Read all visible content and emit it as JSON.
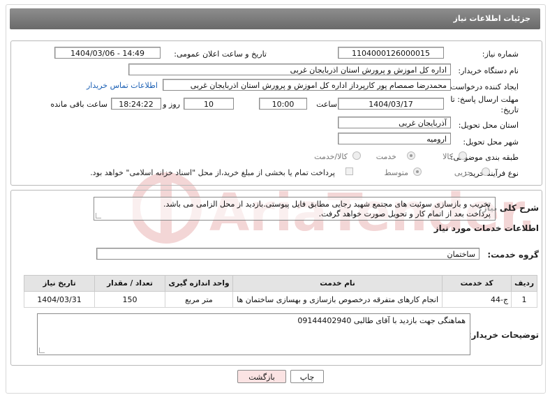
{
  "header": {
    "title": "جزئیات اطلاعات نیاز"
  },
  "form": {
    "need_number_label": "شماره نیاز:",
    "need_number": "1104000126000015",
    "announce_datetime_label": "تاریخ و ساعت اعلان عمومی:",
    "announce_datetime": "1404/03/06 - 14:49",
    "buyer_org_label": "نام دستگاه خریدار:",
    "buyer_org": "اداره کل اموزش و پرورش استان اذربایجان غربی",
    "requester_label": "ایجاد کننده درخواست:",
    "requester": "محمدرضا صمصام پور کارپرداز اداره کل اموزش و پرورش استان اذربایجان غربی",
    "contact_link": "اطلاعات تماس خریدار",
    "deadline_label_1": "مهلت ارسال پاسخ: تا",
    "deadline_label_2": "تاریخ:",
    "deadline_date": "1404/03/17",
    "time_label": "ساعت",
    "deadline_time": "10:00",
    "days_value": "10",
    "days_label": "روز و",
    "remaining_time": "18:24:22",
    "remaining_label": "ساعت باقی مانده",
    "province_label": "استان محل تحویل:",
    "province": "آذربایجان غربی",
    "city_label": "شهر محل تحویل:",
    "city": "ارومیه",
    "category_label": "طبقه بندی موضوعی:",
    "category_options": [
      "کالا",
      "خدمت",
      "کالا/خدمت"
    ],
    "category_selected": "خدمت",
    "process_label": "نوع فرآیند خرید :",
    "process_options": [
      "جزیی",
      "متوسط"
    ],
    "process_selected": "متوسط",
    "payment_note": "پرداخت تمام یا بخشی از مبلغ خرید،از محل \"اسناد خزانه اسلامی\" خواهد بود."
  },
  "description": {
    "label": "شرح کلی نیاز:",
    "line1": "تخریب و بازسازی سوئیت های مجتمع شهید رجایی مطابق فایل پیوستی.بازدید از محل الزامی می باشد.",
    "line2": "پرداخت بعد از اتمام کار و تحویل صورت خواهد گرفت."
  },
  "services": {
    "section_title": "اطلاعات خدمات مورد نیاز",
    "group_label": "گروه خدمت:",
    "group_value": "ساختمان",
    "columns": [
      "ردیف",
      "کد خدمت",
      "نام خدمت",
      "واحد اندازه گیری",
      "تعداد / مقدار",
      "تاریخ نیاز"
    ],
    "rows": [
      [
        "1",
        "ج-44",
        "انجام کارهای متفرقه درخصوص بازسازی و بهسازی ساختمان ها",
        "متر مربع",
        "150",
        "1404/03/31"
      ]
    ]
  },
  "buyer_notes": {
    "label": "توضیحات خریدار:",
    "text": "هماهنگی جهت بازدید با آقای طالبی 09144402940"
  },
  "buttons": {
    "print": "چاپ",
    "back": "بازگشت"
  },
  "watermark": {
    "text": "AriaTender.neT"
  },
  "colors": {
    "header_bg": "#7a7a7a",
    "link": "#1a5fb4",
    "back_button_bg": "#fbe3e3",
    "watermark": "#f3d6d6"
  }
}
